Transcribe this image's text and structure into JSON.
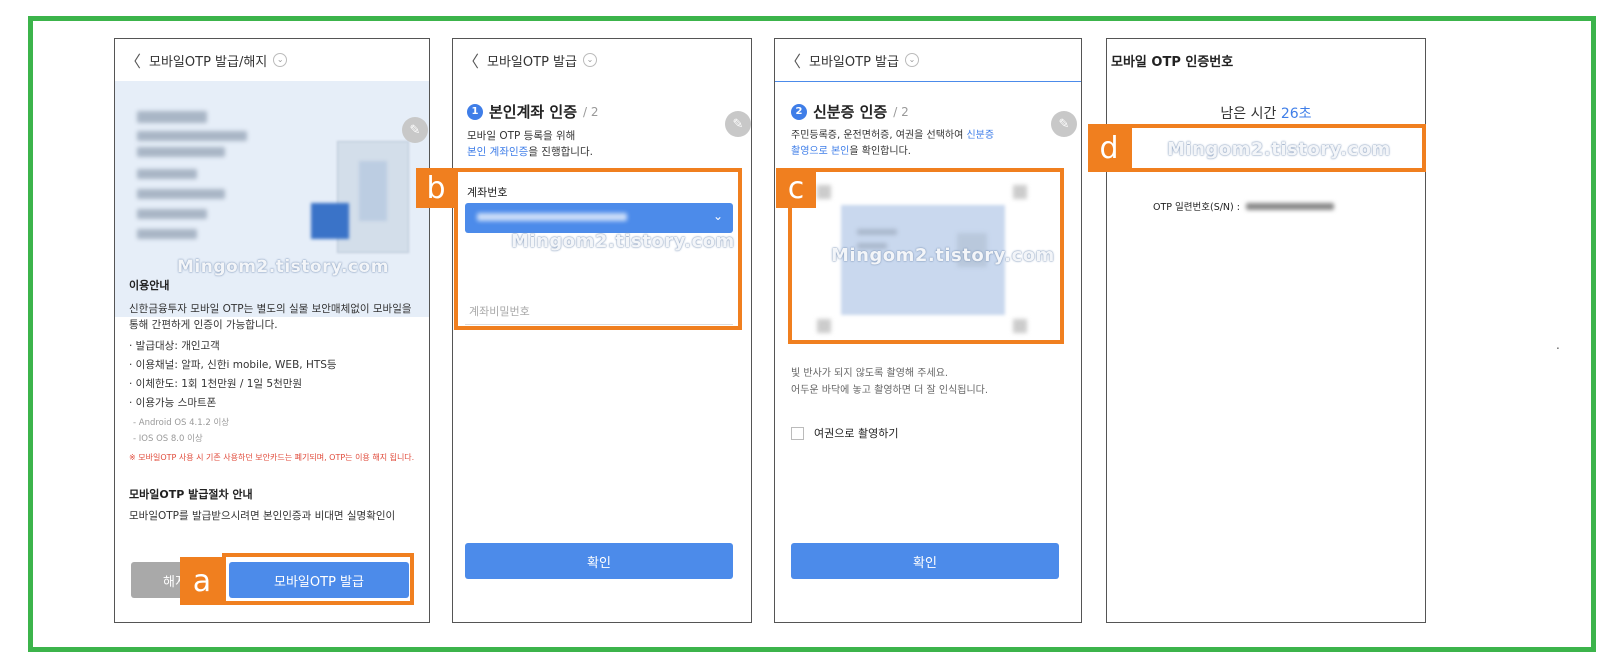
{
  "screen_a": {
    "back": "〈",
    "title": "모바일OTP 발급/해지",
    "watermark": "Mingom2.tistory.com",
    "info_title": "이용안내",
    "info_desc": "신한금융투자 모바일 OTP는 별도의 실물 보안매체없이 모바일을 통해 간편하게 인증이 가능합니다.",
    "bullets": [
      "· 발급대상: 개인고객",
      "· 이용채널: 알파, 신한i mobile, WEB, HTS등",
      "· 이체한도: 1회 1천만원 / 1일 5천만원",
      "· 이용가능 스마트폰"
    ],
    "os": [
      "- Android OS 4.1.2 이상",
      "- IOS OS 8.0 이상"
    ],
    "warning": "※ 모바일OTP 사용 시 기존 사용하던 보안카드는 폐기되며, OTP는 이용 해지 됩니다.",
    "proc_title": "모바일OTP 발급절차 안내",
    "proc_desc": "모바일OTP를 발급받으시려면 본인인증과 비대면 실명확인이",
    "cancel_label": "해지",
    "issue_label": "모바일OTP 발급",
    "tag": "a"
  },
  "screen_b": {
    "back": "〈",
    "title": "모바일OTP 발급",
    "step_num": "1",
    "step_title": "본인계좌 인증",
    "step_frac": "/ 2",
    "desc1": "모바일 OTP 등록을 위해",
    "desc_link": "본인 계좌인증",
    "desc2": "을 진행합니다.",
    "account_label": "계좌번호",
    "password_placeholder": "계좌비밀번호",
    "watermark": "Mingom2.tistory.com",
    "confirm": "확인",
    "tag": "b"
  },
  "screen_c": {
    "back": "〈",
    "title": "모바일OTP 발급",
    "step_num": "2",
    "step_title": "신분증 인증",
    "step_frac": "/ 2",
    "desc1": "주민등록증, 운전면허증, 여권을 선택하여 ",
    "desc_link1": "신분증",
    "desc_link2": "촬영으로 본인",
    "desc2": "을 확인합니다.",
    "watermark": "Mingom2.tistory.com",
    "hint1": "빛 반사가 되지 않도록 촬영해 주세요.",
    "hint2": "어두운 바닥에 놓고 촬영하면 더 잘 인식됩니다.",
    "passport": "여권으로 촬영하기",
    "confirm": "확인",
    "tag": "c"
  },
  "screen_d": {
    "title": "모바일 OTP 인증번호",
    "remain_label": "남은 시간",
    "remain_value": "26초",
    "watermark": "Mingom2.tistory.com",
    "serial_label": "OTP 일련번호(S/N) :",
    "tag": "d"
  },
  "side_mark": "."
}
